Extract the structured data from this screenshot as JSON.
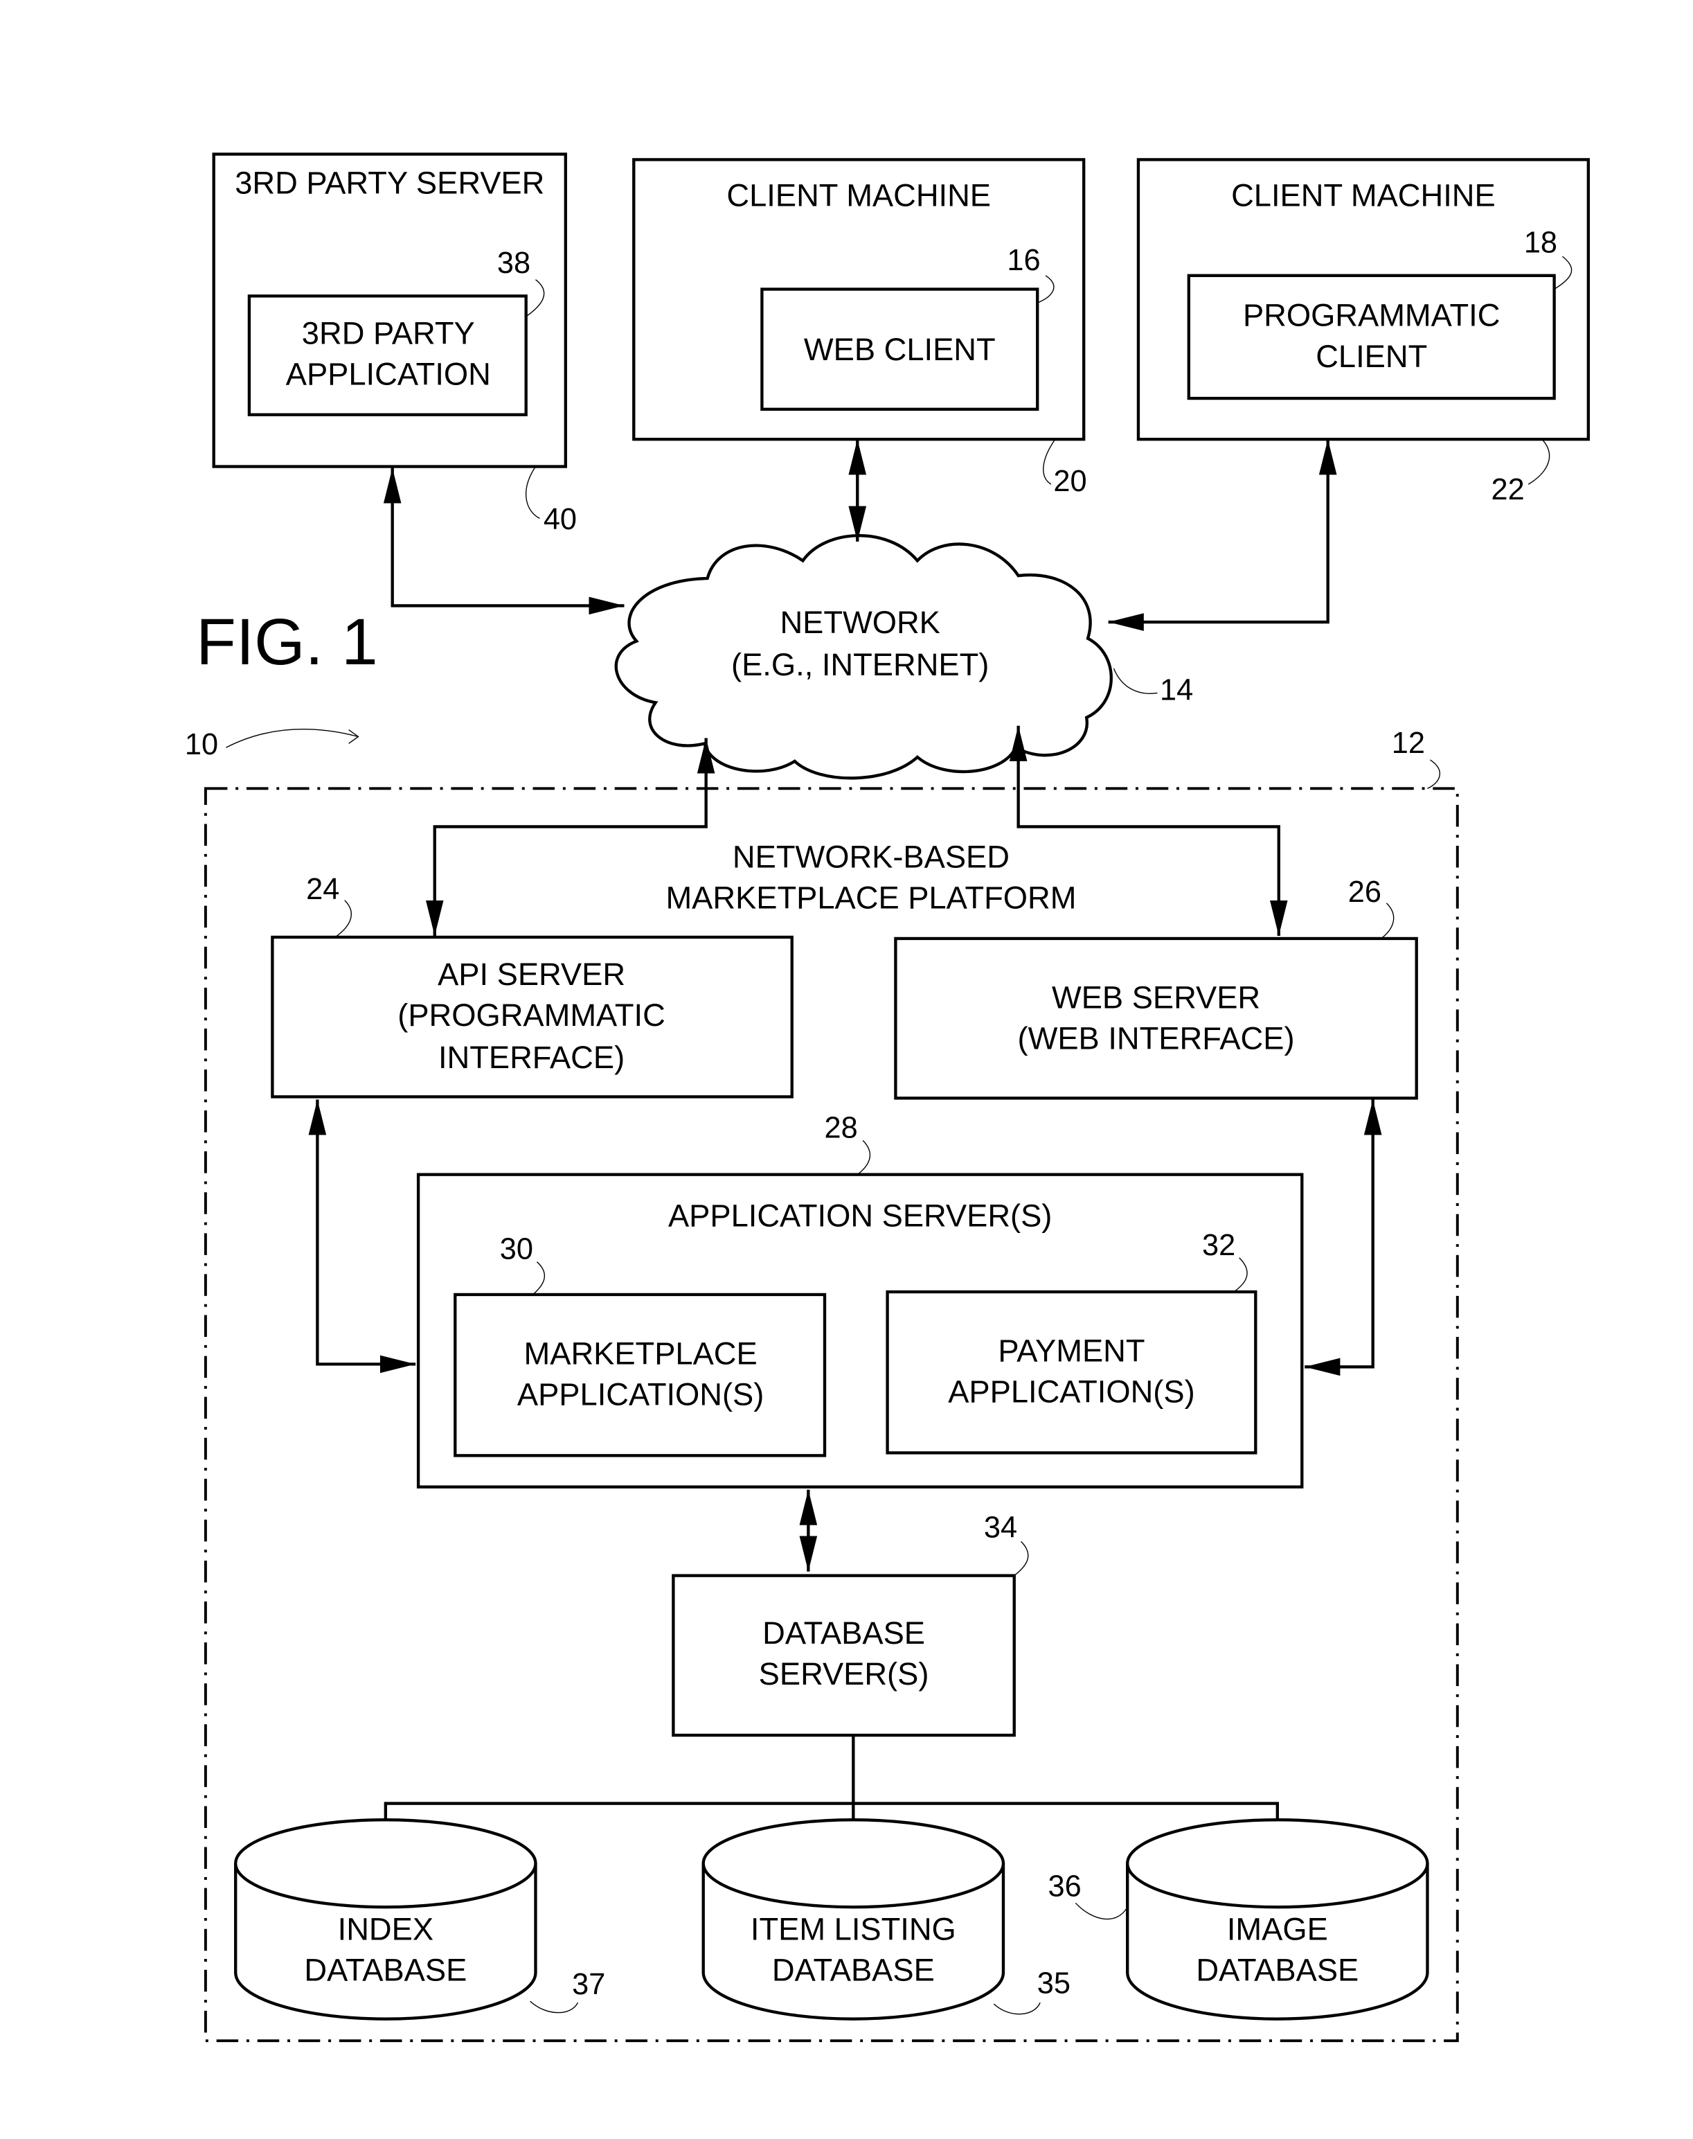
{
  "figure": {
    "title": "FIG. 1",
    "system_ref": "10"
  },
  "nodes": {
    "third_party_server": {
      "title": "3RD PARTY SERVER",
      "ref": "40"
    },
    "third_party_app": {
      "lines": [
        "3RD PARTY",
        "APPLICATION"
      ],
      "ref": "38"
    },
    "client_machine_1": {
      "title": "CLIENT MACHINE",
      "ref": "20"
    },
    "web_client": {
      "lines": [
        "WEB CLIENT"
      ],
      "ref": "16"
    },
    "client_machine_2": {
      "title": "CLIENT MACHINE",
      "ref": "22"
    },
    "programmatic_client": {
      "lines": [
        "PROGRAMMATIC",
        "CLIENT"
      ],
      "ref": "18"
    },
    "network": {
      "lines": [
        "NETWORK",
        "(E.G., INTERNET)"
      ],
      "ref": "14"
    },
    "platform": {
      "lines": [
        "NETWORK-BASED",
        "MARKETPLACE PLATFORM"
      ],
      "ref": "12"
    },
    "api_server": {
      "lines": [
        "API SERVER",
        "(PROGRAMMATIC",
        "INTERFACE)"
      ],
      "ref": "24"
    },
    "web_server": {
      "lines": [
        "WEB SERVER",
        "(WEB INTERFACE)"
      ],
      "ref": "26"
    },
    "app_servers": {
      "title": "APPLICATION SERVER(S)",
      "ref": "28"
    },
    "marketplace_apps": {
      "lines": [
        "MARKETPLACE",
        "APPLICATION(S)"
      ],
      "ref": "30"
    },
    "payment_apps": {
      "lines": [
        "PAYMENT",
        "APPLICATION(S)"
      ],
      "ref": "32"
    },
    "database_servers": {
      "lines": [
        "DATABASE",
        "SERVER(S)"
      ],
      "ref": "34"
    },
    "index_db": {
      "lines": [
        "INDEX",
        "DATABASE"
      ],
      "ref": "37"
    },
    "item_listing_db": {
      "lines": [
        "ITEM LISTING",
        "DATABASE"
      ],
      "ref": "35"
    },
    "image_db": {
      "lines": [
        "IMAGE",
        "DATABASE"
      ],
      "ref": "36"
    }
  }
}
